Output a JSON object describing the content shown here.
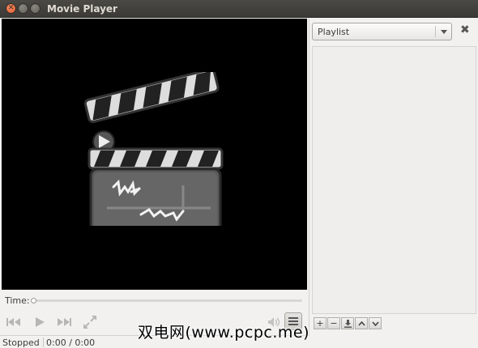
{
  "window": {
    "title": "Movie Player"
  },
  "time": {
    "label": "Time:",
    "progress": 0
  },
  "status": {
    "state": "Stopped",
    "position": "0:00 / 0:00"
  },
  "sidebar": {
    "selector_value": "Playlist",
    "close_icon": "close-icon"
  },
  "playlist_buttons": [
    "add-icon",
    "remove-icon",
    "save-icon",
    "move-up-icon",
    "move-down-icon"
  ],
  "controls": [
    "previous-icon",
    "play-icon",
    "next-icon",
    "fullscreen-icon",
    "volume-icon",
    "playlist-toggle-icon"
  ],
  "watermark": "双电网(www.pcpc.me)",
  "colors": {
    "titlebar": "#3c3b37",
    "close_button": "#e9613a",
    "video_bg": "#000000",
    "window_bg": "#f2f1f0"
  }
}
